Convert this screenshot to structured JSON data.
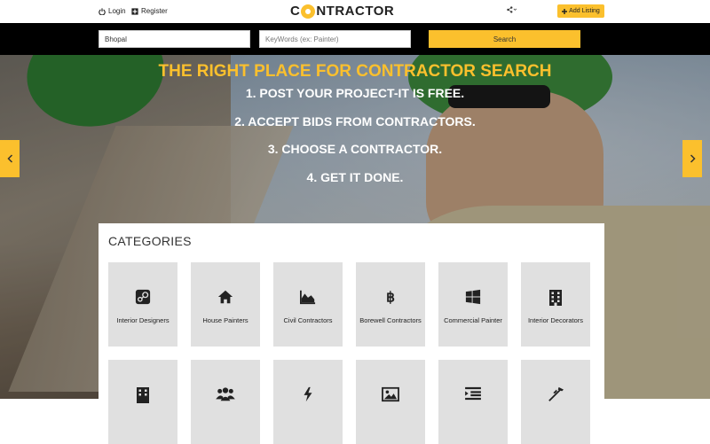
{
  "topbar": {
    "login_label": "Login",
    "register_label": "Register",
    "logo_before": "C",
    "logo_after": "NTRACTOR",
    "add_listing_label": "Add Listing"
  },
  "search": {
    "location_value": "Bhopal",
    "keywords_placeholder": "KeyWords (ex: Painter)",
    "button_label": "Search"
  },
  "hero": {
    "headline": "THE RIGHT PLACE FOR CONTRACTOR SEARCH",
    "steps": [
      "1. POST YOUR PROJECT-IT IS FREE.",
      "2. ACCEPT BIDS FROM CONTRACTORS.",
      "3. CHOOSE A CONTRACTOR.",
      "4. GET IT DONE."
    ]
  },
  "categories": {
    "title": "CATEGORIES",
    "items": [
      {
        "label": "Interior Designers",
        "icon": "steam-icon"
      },
      {
        "label": "House Painters",
        "icon": "home-icon"
      },
      {
        "label": "Civil Contractors",
        "icon": "area-chart-icon"
      },
      {
        "label": "Borewell Contractors",
        "icon": "bitcoin-icon"
      },
      {
        "label": "Commercial Painter",
        "icon": "windows-icon"
      },
      {
        "label": "Interior Decorators",
        "icon": "building-icon"
      },
      {
        "label": "",
        "icon": "building-icon"
      },
      {
        "label": "",
        "icon": "users-icon"
      },
      {
        "label": "",
        "icon": "bolt-icon"
      },
      {
        "label": "",
        "icon": "image-icon"
      },
      {
        "label": "",
        "icon": "indent-icon"
      },
      {
        "label": "",
        "icon": "tools-icon"
      }
    ]
  },
  "colors": {
    "accent": "#fbc02d",
    "search_bar": "#000000",
    "tile_bg": "#e0e0e0"
  }
}
